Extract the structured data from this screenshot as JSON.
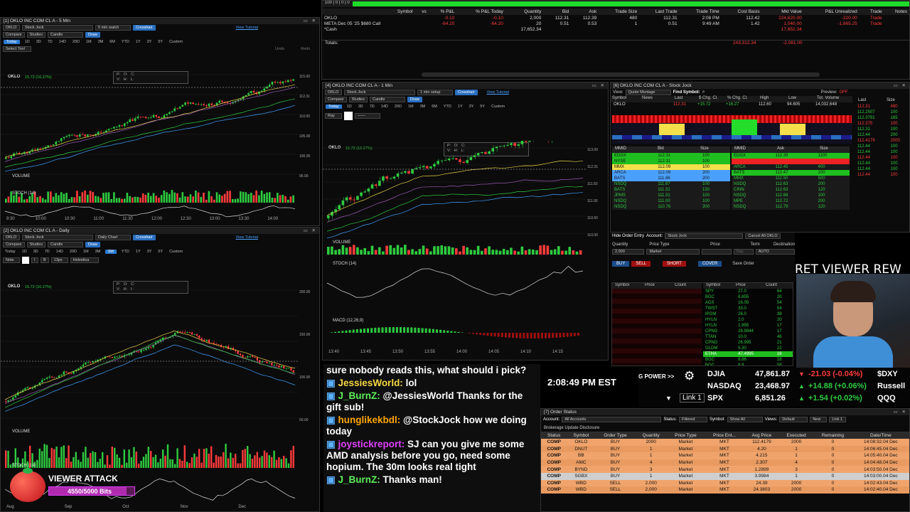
{
  "colors": {
    "up": "#2ecc40",
    "down": "#ff3b3b",
    "accent": "#2a6fc0",
    "bg": "#000000"
  },
  "positions": {
    "topbar": "100 | 0 | 0 | 0",
    "headers": [
      "Symbol",
      "vs",
      "% P&L",
      "% P&L Today",
      "Quantity",
      "Bid",
      "Ask",
      "Trade Size",
      "Last Trade",
      "Trade Time",
      "Cost Basis",
      "Mkt Value",
      "P&L Unrealized",
      "Trade",
      "Notes"
    ],
    "rows": [
      {
        "sym": "OKLO",
        "pl": "-0.10",
        "pltoday": "-0.10",
        "qty": "2,000",
        "bid": "112.31",
        "ask": "112.39",
        "size": "480",
        "last": "112.31",
        "time": "2:08 PM",
        "cost": "112.42",
        "mkt": "224,620.00",
        "unreal": "-220.00",
        "trade": "Trade"
      },
      {
        "sym": "META Dec 05 '25 $680 Call",
        "pl": "-64.20",
        "pltoday": "-64.20",
        "qty": "20",
        "bid": "0.51",
        "ask": "0.53",
        "size": "1",
        "last": "0.51",
        "time": "9:49 AM",
        "cost": "1.42",
        "mkt": "1,040.00",
        "unreal": "-1,865.25",
        "trade": "Trade"
      },
      {
        "sym": "*Cash",
        "qty": "17,652.34",
        "mkt": "17,652.34"
      }
    ],
    "totals_label": "Totals:",
    "totals_mkt": "243,312.34",
    "totals_unreal": "-2,081.00"
  },
  "chart5": {
    "title": "[1] OKLO INC COM CL A - 5 Min",
    "symbol": "OKLO",
    "profile": "Stock Jock",
    "interval": "5 min watch",
    "crosshair": "Crosshair",
    "tutorial": "View Tutorial",
    "compare": "Compare",
    "studies": "Studies",
    "candle": "Candle",
    "draw": "Draw",
    "select_tool": "Select Tool",
    "undo": "Undo",
    "redo": "Redo",
    "label": "OKLO",
    "price": "112.31",
    "chg": "15.72 (16.27%)",
    "volume": "VOLUME",
    "stoch": "STOCH (14)",
    "times": [
      "9:30",
      "10:00",
      "10:30",
      "11:00",
      "11:30",
      "12:00",
      "12:30",
      "13:00",
      "13:30",
      "14:00"
    ],
    "prices": [
      "115.00",
      "112.31",
      "110.00",
      "105.00",
      "100.00",
      "95.00"
    ]
  },
  "chartD": {
    "title": "[2] OKLO INC COM CL A - Daily",
    "symbol": "OKLO",
    "profile": "Stock Jock",
    "interval": "Daily Chart",
    "crosshair": "Crosshair",
    "tutorial": "View Tutorial",
    "note": "Note",
    "bold": "B",
    "italic": "I",
    "fontsize": "13px",
    "font": "Helvetica",
    "label": "OKLO",
    "price": "112.31",
    "chg": "15.72 (16.27%)",
    "volume": "VOLUME",
    "stoch": "STOCH (14)",
    "months": [
      "Aug",
      "Sep",
      "Oct",
      "Nov",
      "Dec"
    ],
    "days": [
      "14",
      "14",
      "14"
    ],
    "prices": [
      "200.00",
      "150.00",
      "100.00",
      "50.00"
    ]
  },
  "chart1": {
    "title": "[4] OKLO INC COM CL A - 1 Min",
    "symbol": "OKLO",
    "profile": "Stock Jock",
    "interval": "1 min setup",
    "crosshair": "Crosshair",
    "tutorial": "View Tutorial",
    "ray": "Ray",
    "label": "OKLO",
    "price": "112.31",
    "chg": "15.72 (16.27%)",
    "volume": "VOLUME",
    "stoch": "STOCH (14)",
    "macd": "MACD (12,26,9)",
    "times": [
      "13:40",
      "13:45",
      "13:50",
      "13:55",
      "14:00",
      "14:05",
      "14:10",
      "14:15"
    ],
    "prices": [
      "113.00",
      "112.31",
      "111.50",
      "111.00",
      "110.50",
      "110.00"
    ]
  },
  "timeframes": [
    "Today",
    "1D",
    "3D",
    "7D",
    "14D",
    "20D",
    "1M",
    "3M",
    "6M",
    "YTD",
    "1Y",
    "3Y",
    "5Y",
    "Custom"
  ],
  "stock": {
    "title": "[6] OKLO INC COM CL A - Stock Jock",
    "view": "View:",
    "view_val": "Quote Montage",
    "find": "Find Symbol:",
    "preview": "Preview:",
    "preview_val": "OFF",
    "cols": [
      "Symbol",
      "News",
      "Last",
      "$ Chg. Cl.",
      "% Chg. Cl.",
      "High",
      "Low",
      "Tot. Volume"
    ],
    "q": {
      "sym": "OKLO",
      "last": "112.31",
      "chg": "+15.72",
      "pct": "+16.27",
      "high": "112.60",
      "low": "94.605",
      "vol": "14,032,648"
    },
    "bid_head": [
      "MMID",
      "Bid",
      "Size"
    ],
    "ask_head": [
      "MMID",
      "Ask",
      "Size"
    ],
    "bids": [
      [
        "EDGX",
        "112.31",
        "100"
      ],
      [
        "NYSE",
        "112.31",
        "100"
      ],
      [
        "MMX",
        "112.09",
        "100"
      ],
      [
        "ARCA",
        "112.09",
        "200"
      ],
      [
        "BATS",
        "111.86",
        "200"
      ],
      [
        "NSDQ",
        "111.67",
        "100"
      ],
      [
        "BATS",
        "111.31",
        "130"
      ],
      [
        "JPMS",
        "111.31",
        "100"
      ],
      [
        "NSDQ",
        "111.00",
        "100"
      ],
      [
        "NSDQ",
        "110.76",
        "200"
      ]
    ],
    "asks": [
      [
        "EDGX",
        "112.39",
        "1100"
      ],
      [
        "",
        "",
        ""
      ],
      [
        "ARCA",
        "112.45",
        "400"
      ],
      [
        "BATS",
        "112.47",
        "100"
      ],
      [
        "MMX",
        "112.50",
        "500"
      ],
      [
        "NSDQ",
        "112.63",
        "200"
      ],
      [
        "CINN",
        "112.63",
        "120"
      ],
      [
        "NSDQ",
        "112.68",
        "100"
      ],
      [
        "MPE",
        "112.72",
        "200"
      ],
      [
        "NSDQ",
        "112.79",
        "120"
      ]
    ],
    "tape": [
      [
        "112.31",
        "480"
      ],
      [
        "112.2507",
        "100"
      ],
      [
        "112.3791",
        "165"
      ],
      [
        "112.375",
        "100"
      ],
      [
        "112.31",
        "100"
      ],
      [
        "112.44",
        "200"
      ],
      [
        "112.4179",
        "2000"
      ],
      [
        "112.44",
        "100"
      ],
      [
        "112.44",
        "100"
      ],
      [
        "112.44",
        "100"
      ],
      [
        "112.44",
        "100"
      ],
      [
        "112.44",
        "100"
      ],
      [
        "112.44",
        "100"
      ]
    ],
    "tape_head": [
      "Last",
      "Size"
    ],
    "order_hide": "Hide Order Entry",
    "account": "Account:",
    "account_val": "Stock Jock",
    "cancel_all": "Cancel All OKLO",
    "qty": "Quantity",
    "qty_val": "2,000",
    "ptype": "Price Type",
    "ptype_val": "Market",
    "price": "Price",
    "term": "Term",
    "term_val": "Day",
    "dest": "Destination",
    "dest_val": "AUTO",
    "aon": "AON",
    "buy": "BUY",
    "sell": "SELL",
    "short": "SHORT",
    "cover": "COVER",
    "save": "Save Order",
    "reserve": "Reserve",
    "ts_head": [
      "Symbol",
      "Price",
      "Count"
    ],
    "ts_l": [
      [
        "OKLO",
        "112.31",
        "1"
      ],
      [
        "",
        "",
        ""
      ],
      [
        "",
        "",
        ""
      ]
    ],
    "ts_r": [
      [
        "SPY",
        "27.0",
        "64"
      ],
      [
        "BGC",
        "8.855",
        "20"
      ],
      [
        "AGX",
        "16.05",
        "54"
      ],
      [
        "TWST",
        "33.0",
        "54"
      ],
      [
        "IPGM",
        "26.0",
        "38"
      ],
      [
        "HYLN",
        "2.0",
        "20"
      ],
      [
        "HYLN",
        "1.995",
        "17"
      ],
      [
        "CPNG",
        "28.9944",
        "17"
      ],
      [
        "TTAN",
        "10.0",
        "46"
      ],
      [
        "CPNG",
        "26.995",
        "21"
      ],
      [
        "GLDM",
        "5.30",
        "22"
      ],
      [
        "ETHA",
        "47.4995",
        "16"
      ],
      [
        "BGC",
        "8.86",
        "18"
      ],
      [
        "BGC",
        "8.8",
        "58"
      ]
    ]
  },
  "ticker": {
    "bp": "G POWER >>",
    "link": "Link 1",
    "clock": "2:08:49 PM EST",
    "rows": [
      {
        "n": "DJIA",
        "v": "47,861.87",
        "c": "-21.03 (-0.04%)",
        "t": "$DXY",
        "up": false
      },
      {
        "n": "NASDAQ",
        "v": "23,468.97",
        "c": "+14.88 (+0.06%)",
        "t": "Russell",
        "up": true
      },
      {
        "n": "SPX",
        "v": "6,851.26",
        "c": "+1.54 (+0.02%)",
        "t": "QQQ",
        "up": true
      }
    ]
  },
  "banner": "RET VIEWER REW",
  "chat": [
    {
      "u": "",
      "t": "sure nobody reads this, what should i pick?",
      "cls": ""
    },
    {
      "u": "JessiesWorld:",
      "t": "lol",
      "cls": "user-y"
    },
    {
      "u": "J_BurnZ:",
      "t": "@JessiesWorld Thanks for the gift sub!",
      "cls": "user-g"
    },
    {
      "u": "hunglikekbdl:",
      "t": "@StockJock how we doing today",
      "cls": "user-o"
    },
    {
      "u": "joystickreport:",
      "t": "SJ can you give me some AMD analysis before you go, need some hopium. The 30m looks real tight",
      "cls": "user-m"
    },
    {
      "u": "J_BurnZ:",
      "t": "Thanks man!",
      "cls": "user-g"
    }
  ],
  "attack": {
    "title": "VIEWER ATTACK",
    "bits": "4550/5000 Bits",
    "progress": 0.91
  },
  "orders": {
    "title": "[7] Order Status",
    "account": "Account:",
    "account_val": "All Accounts",
    "status": "Status:",
    "status_val": "Filtered",
    "symbol": "Symbol:",
    "symbol_val": "Show All",
    "views": "Views:",
    "views_val": "Default",
    "new": "New",
    "link": "Link 1",
    "disclosure": "Brokerage Update Disclosure",
    "head": [
      "Status",
      "Symbol",
      "Order Type",
      "Quantity",
      "Price Type",
      "Price Ent...",
      "Avg Price",
      "Executed",
      "Remaining",
      "Date/Time"
    ],
    "rows": [
      [
        "COMP",
        "OKLO",
        "BUY",
        "2000",
        "Market",
        "MKT",
        "112.4179",
        "2000",
        "0",
        "14:08:32.04 Dec"
      ],
      [
        "COMP",
        "DNUT",
        "BUY",
        "1",
        "Market",
        "MKT",
        "4.20",
        "1",
        "0",
        "14:06:45.04 Dec"
      ],
      [
        "COMP",
        "BB",
        "BUY",
        "1",
        "Market",
        "MKT",
        "4.215",
        "1",
        "0",
        "14:05:40.04 Dec"
      ],
      [
        "COMP",
        "AMC",
        "BUY",
        "4",
        "Market",
        "MKT",
        "2.307",
        "4",
        "0",
        "14:04:48.04 Dec"
      ],
      [
        "COMP",
        "BYND",
        "BUY",
        "3",
        "Market",
        "MKT",
        "1.2899",
        "3",
        "0",
        "14:03:50.04 Dec"
      ],
      [
        "COMP",
        "SGBX",
        "BUY",
        "1",
        "Market",
        "MKT",
        "3.9984",
        "1",
        "0",
        "14:03:00.04 Dec"
      ],
      [
        "COMP",
        "WBD",
        "SELL",
        "2,000",
        "Market",
        "MKT",
        "24.39",
        "2000",
        "0",
        "14:02:43.04 Dec"
      ],
      [
        "COMP",
        "WBD",
        "SELL",
        "2,000",
        "Market",
        "MKT",
        "24.3803",
        "2000",
        "0",
        "14:02:40.04 Dec"
      ]
    ]
  }
}
